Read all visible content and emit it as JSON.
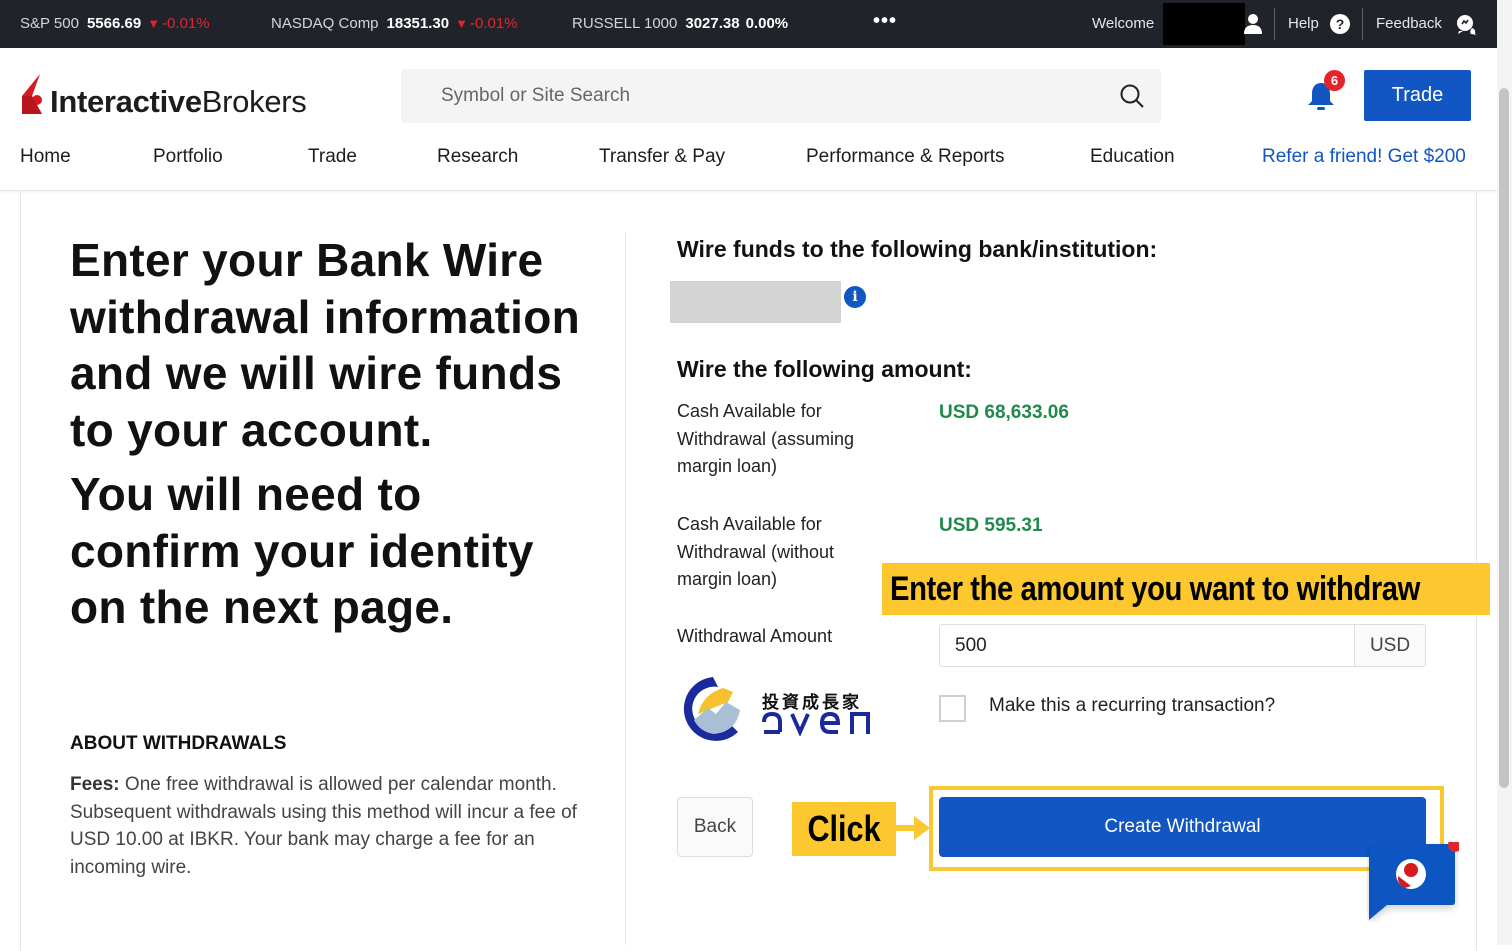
{
  "ticker": {
    "items": [
      {
        "name": "S&P 500",
        "value": "5566.69",
        "change": "-0.01%",
        "direction": "down"
      },
      {
        "name": "NASDAQ Comp",
        "value": "18351.30",
        "change": "-0.01%",
        "direction": "down"
      },
      {
        "name": "RUSSELL 1000",
        "value": "3027.38",
        "change": "0.00%",
        "direction": "flat"
      }
    ],
    "more_icon": "•••",
    "welcome_label": "Welcome",
    "help_label": "Help",
    "help_icon": "?",
    "feedback_label": "Feedback"
  },
  "header": {
    "logo_bold": "Interactive",
    "logo_regular": "Brokers",
    "search_placeholder": "Symbol or Site Search",
    "notification_count": "6",
    "trade_button": "Trade"
  },
  "nav": {
    "items": [
      "Home",
      "Portfolio",
      "Trade",
      "Research",
      "Transfer & Pay",
      "Performance & Reports",
      "Education"
    ],
    "refer_link": "Refer a friend! Get $200"
  },
  "left": {
    "hero_1": "Enter your Bank Wire withdrawal information and we will wire funds to your account.",
    "hero_2": "You will need to confirm your identity on the next page.",
    "about_heading": "ABOUT WITHDRAWALS",
    "fees_label": "Fees:",
    "fees_text": " One free withdrawal is allowed per calendar month. Subsequent withdrawals using this method will incur a fee of USD 10.00 at IBKR. Your bank may charge a fee for an incoming wire."
  },
  "right": {
    "bank_heading": "Wire funds to the following bank/institution:",
    "info_icon": "i",
    "amount_heading": "Wire the following amount:",
    "cash_margin_label": "Cash Available for Withdrawal (assuming margin loan)",
    "cash_margin_value": "USD 68,633.06",
    "cash_nomargin_label": "Cash Available for Withdrawal (without margin loan)",
    "cash_nomargin_value": "USD 595.31",
    "withdrawal_amount_label": "Withdrawal Amount",
    "withdrawal_amount_value": "500",
    "currency": "USD",
    "recurring_label": "Make this a recurring transaction?",
    "recurring_checked": false,
    "back_button": "Back",
    "create_button": "Create Withdrawal"
  },
  "annotations": {
    "enter_amount": "Enter the amount you want to withdraw",
    "click": "Click",
    "highlight_color": "#fcc72f"
  },
  "watermark": {
    "cn": "投資成長家",
    "en": "GVEN"
  },
  "colors": {
    "brand_blue": "#1156c2",
    "positive_green": "#1f8a4c",
    "negative_red": "#e3242b",
    "ticker_bg": "#20232a"
  }
}
